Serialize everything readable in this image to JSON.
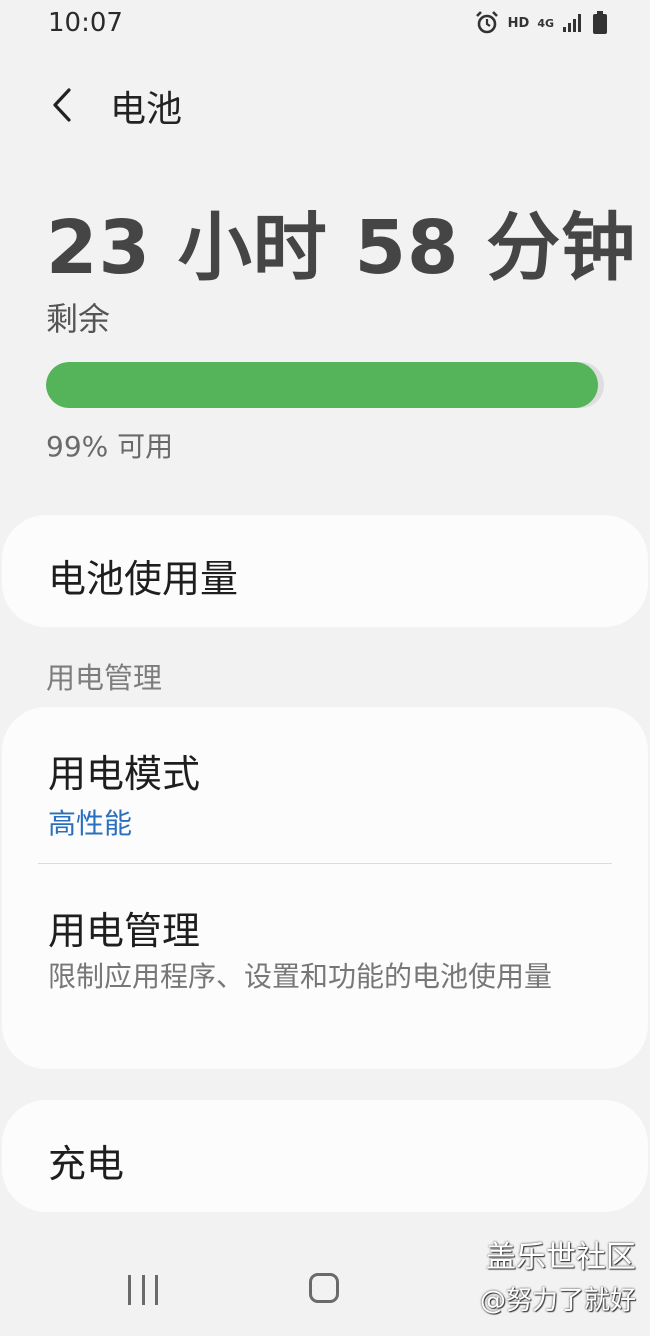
{
  "status_bar": {
    "time": "10:07",
    "hd": "HD",
    "network": "4G",
    "icons": [
      "alarm-icon",
      "hd-icon",
      "4g-icon",
      "signal-icon",
      "battery-icon"
    ]
  },
  "header": {
    "back_icon": "chevron-left-icon",
    "title": "电池"
  },
  "battery": {
    "remaining_time": "23 小时 58 分钟",
    "remaining_label": "剩余",
    "percent_value": 99,
    "percent_text": "99% 可用",
    "fill_color": "#55b35a"
  },
  "usage": {
    "label": "电池使用量"
  },
  "power_management": {
    "section_title": "用电管理",
    "mode": {
      "label": "用电模式",
      "value": "高性能"
    },
    "manage": {
      "label": "用电管理",
      "description": "限制应用程序、设置和功能的电池使用量"
    }
  },
  "charging": {
    "label": "充电"
  },
  "nav": {
    "icons": [
      "recent-apps-icon",
      "home-icon"
    ]
  },
  "watermark": {
    "line1": "盖乐世社区",
    "line2": "@努力了就好"
  },
  "colors": {
    "accent": "#2a6fbd",
    "battery_green": "#55b35a",
    "background": "#f2f2f2"
  }
}
